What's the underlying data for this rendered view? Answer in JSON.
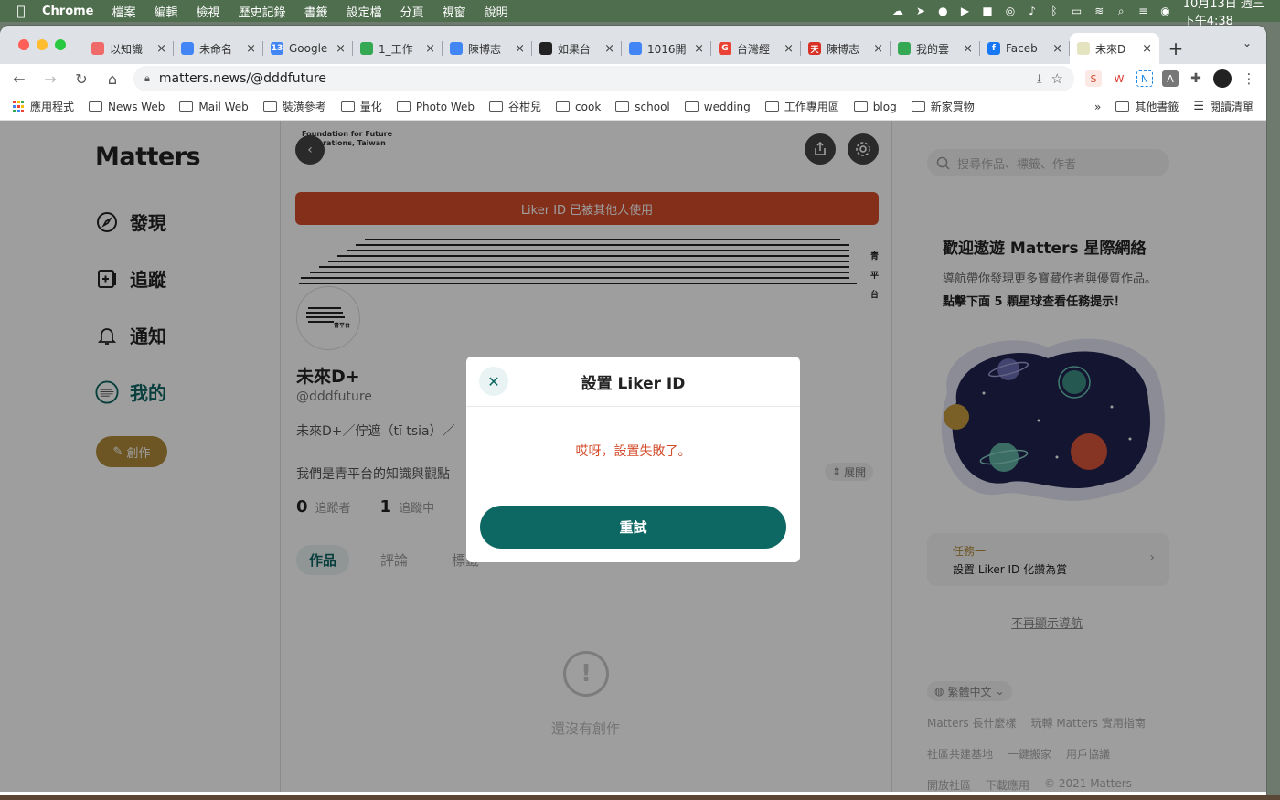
{
  "menubar": {
    "app": "Chrome",
    "items": [
      "檔案",
      "編輯",
      "檢視",
      "歷史記錄",
      "書籤",
      "設定檔",
      "分頁",
      "視窗",
      "說明"
    ],
    "clock": "10月13日 週三 下午4:38"
  },
  "tabs": [
    {
      "title": "以知識",
      "fav_color": "#f06a6a"
    },
    {
      "title": "未命名",
      "fav_color": "#4285f4"
    },
    {
      "title": "Google",
      "fav_color": "#4285f4",
      "fav_text": "13"
    },
    {
      "title": "1_工作",
      "fav_color": "#34a853"
    },
    {
      "title": "陳博志",
      "fav_color": "#4285f4"
    },
    {
      "title": "如果台",
      "fav_color": "#222222"
    },
    {
      "title": "1016開",
      "fav_color": "#4285f4"
    },
    {
      "title": "台灣經",
      "fav_color": "#ea4335",
      "fav_text": "G"
    },
    {
      "title": "陳博志",
      "fav_color": "#d93025",
      "fav_text": "天"
    },
    {
      "title": "我的雲",
      "fav_color": "#34a853"
    },
    {
      "title": "Faceb",
      "fav_color": "#1877f2",
      "fav_text": "f"
    },
    {
      "title": "未來D",
      "fav_color": "#e4e4c0",
      "active": true
    }
  ],
  "url": "matters.news/@dddfuture",
  "bookmarks": [
    "應用程式",
    "News Web",
    "Mail Web",
    "裝潢參考",
    "量化",
    "Photo Web",
    "谷柑兒",
    "cook",
    "school",
    "wedding",
    "工作專用區",
    "blog",
    "新家買物"
  ],
  "bookmarks_right": [
    "»",
    "其他書籤",
    "閱讀清單"
  ],
  "sidebar": {
    "logo": "Matters",
    "nav": [
      {
        "label": "發現",
        "icon": "compass-icon"
      },
      {
        "label": "追蹤",
        "icon": "follow-icon"
      },
      {
        "label": "通知",
        "icon": "bell-icon"
      },
      {
        "label": "我的",
        "icon": "avatar-icon",
        "active": true
      }
    ],
    "create": "創作"
  },
  "main": {
    "org_caption": "Foundation for Future Generations, Taiwan",
    "banner": "Liker ID 已被其他人使用",
    "cover_vertical": "青平台",
    "avatar_text": "青平台",
    "name": "未來D+",
    "handle": "@dddfuture",
    "bio_line1": "未來D+／佇遮（tī tsia）／",
    "bio_line2": "我們是青平台的知識與觀點",
    "expand": "展開",
    "followers_count": "0",
    "followers_label": "追蹤者",
    "following_count": "1",
    "following_label": "追蹤中",
    "tabs": [
      "作品",
      "評論",
      "標籤"
    ],
    "empty": "還沒有創作"
  },
  "right": {
    "search_placeholder": "搜尋作品、標籤、作者",
    "welcome_title": "歡迎遨遊 Matters 星際網絡",
    "welcome_sub1": "導航帶你發現更多寶藏作者與優質作品。",
    "welcome_sub2": "點擊下面 5 顆星球查看任務提示！",
    "task_label": "任務一",
    "task_title": "設置 Liker ID 化讚為賞",
    "hide_guide": "不再顯示導航",
    "lang": "繁體中文",
    "footer": [
      [
        "Matters 長什麼樣",
        "玩轉 Matters 實用指南"
      ],
      [
        "社區共建基地",
        "一鍵搬家",
        "用戶協議"
      ],
      [
        "開放社區",
        "下載應用",
        "© 2021 Matters"
      ]
    ]
  },
  "modal": {
    "title": "設置 Liker ID",
    "message": "哎呀，設置失敗了。",
    "retry": "重試"
  },
  "colors": {
    "brand_green": "#0d6763",
    "error_red": "#d34c2b",
    "gold": "#b18c39"
  }
}
